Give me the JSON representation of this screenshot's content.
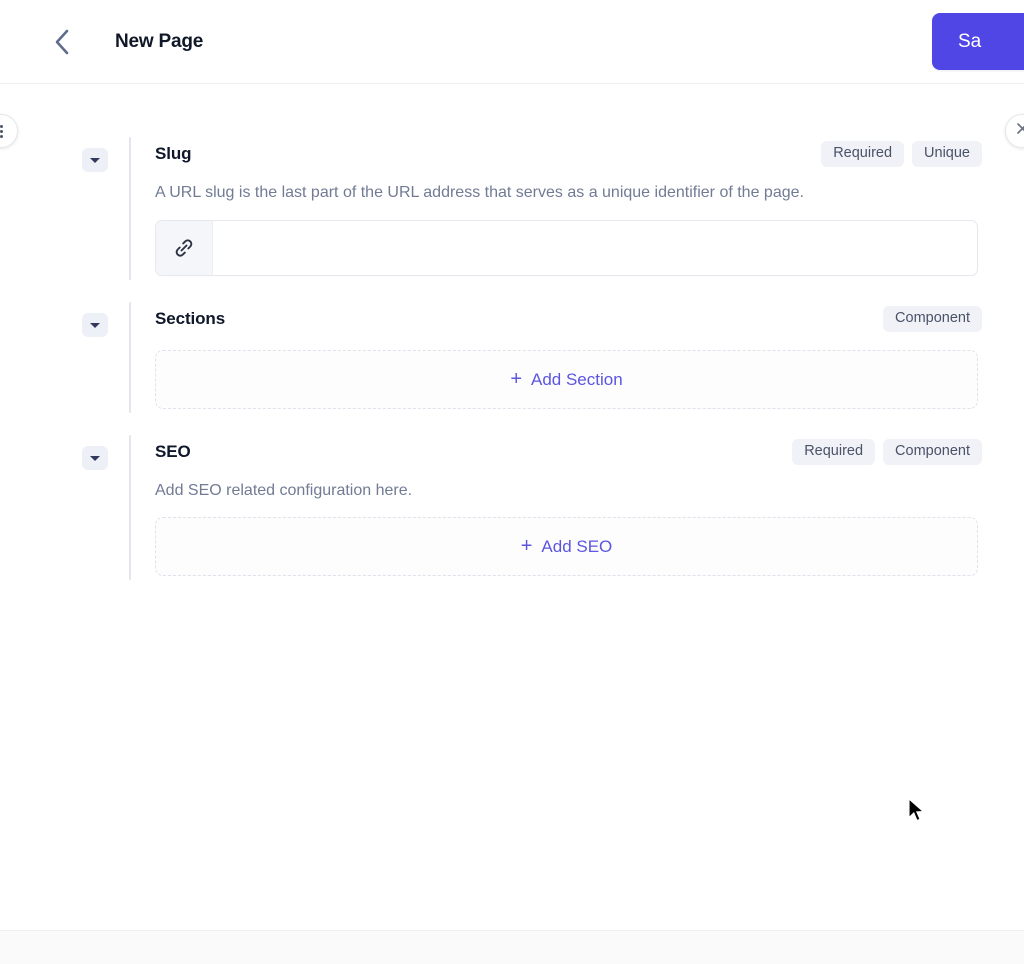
{
  "header": {
    "back_icon": "chevron-left-icon",
    "title": "New Page",
    "save_label": "Sa",
    "save_color": "#4f46e5"
  },
  "edge_buttons": {
    "left_icon": "more-vertical-icon",
    "right_icon": "close-icon",
    "right_glyph": "✕"
  },
  "fields": [
    {
      "label": "Slug",
      "badges": [
        "Required",
        "Unique"
      ],
      "description": "A URL slug is the last part of the URL address that serves as a unique identifier of the page.",
      "input": {
        "icon": "link-icon",
        "value": "",
        "placeholder": ""
      },
      "toggle_icon": "caret-down-icon"
    },
    {
      "label": "Sections",
      "badges": [
        "Component"
      ],
      "description": "",
      "add_button": {
        "plus": "+",
        "label": "Add Section"
      },
      "toggle_icon": "caret-down-icon"
    },
    {
      "label": "SEO",
      "badges": [
        "Required",
        "Component"
      ],
      "description": "Add SEO related configuration here.",
      "add_button": {
        "plus": "+",
        "label": "Add SEO"
      },
      "toggle_icon": "caret-down-icon"
    }
  ],
  "colors": {
    "accent": "#4f46e5",
    "link": "#5b55e0",
    "badge_bg": "#f1f2f7",
    "badge_text": "#4a5268",
    "muted_text": "#717b94",
    "rail": "#e3e6ed"
  }
}
